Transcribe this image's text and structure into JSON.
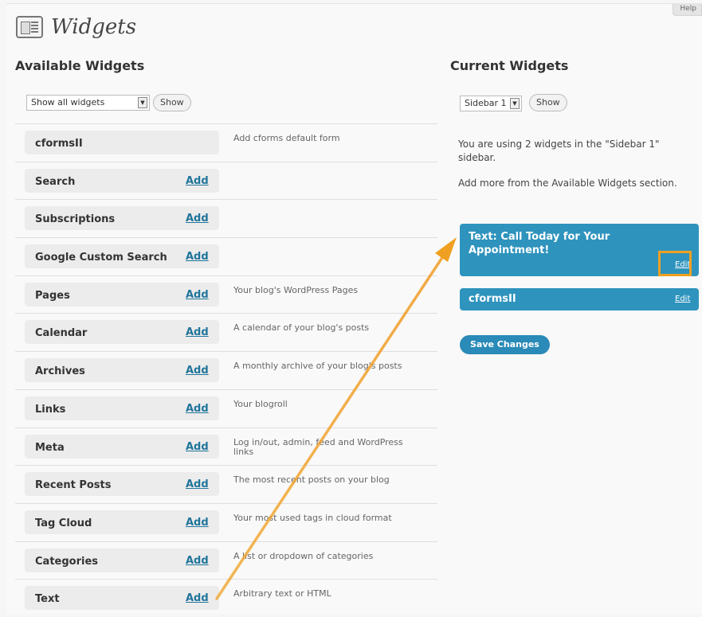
{
  "help_tab": "Help",
  "page": {
    "title": "Widgets",
    "icon": "widgets-icon"
  },
  "available": {
    "title": "Available Widgets",
    "filter_value": "Show all widgets",
    "show_label": "Show",
    "widgets": [
      {
        "name": "cformsII",
        "add": "",
        "desc": "Add cforms default form"
      },
      {
        "name": "Search",
        "add": "Add",
        "desc": ""
      },
      {
        "name": "Subscriptions",
        "add": "Add",
        "desc": ""
      },
      {
        "name": "Google Custom Search",
        "add": "Add",
        "desc": ""
      },
      {
        "name": "Pages",
        "add": "Add",
        "desc": "Your blog's WordPress Pages"
      },
      {
        "name": "Calendar",
        "add": "Add",
        "desc": "A calendar of your blog's posts"
      },
      {
        "name": "Archives",
        "add": "Add",
        "desc": "A monthly archive of your blog's posts"
      },
      {
        "name": "Links",
        "add": "Add",
        "desc": "Your blogroll"
      },
      {
        "name": "Meta",
        "add": "Add",
        "desc": "Log in/out, admin, feed and WordPress links"
      },
      {
        "name": "Recent Posts",
        "add": "Add",
        "desc": "The most recent posts on your blog"
      },
      {
        "name": "Tag Cloud",
        "add": "Add",
        "desc": "Your most used tags in cloud format"
      },
      {
        "name": "Categories",
        "add": "Add",
        "desc": "A list or dropdown of categories"
      },
      {
        "name": "Text",
        "add": "Add",
        "desc": "Arbitrary text or HTML"
      }
    ]
  },
  "current": {
    "title": "Current Widgets",
    "sidebar_value": "Sidebar 1",
    "show_label": "Show",
    "info": "You are using 2 widgets in the \"Sidebar 1\" sidebar.",
    "hint": "Add more from the Available Widgets section.",
    "widgets": [
      {
        "title": "Text: Call Today for Your Appointment!",
        "edit": "Edit"
      },
      {
        "title": "cformsII",
        "edit": "Edit"
      }
    ],
    "save_label": "Save Changes"
  },
  "colors": {
    "accent": "#2e93bd",
    "link": "#21759b",
    "annotation": "#f0a020"
  }
}
